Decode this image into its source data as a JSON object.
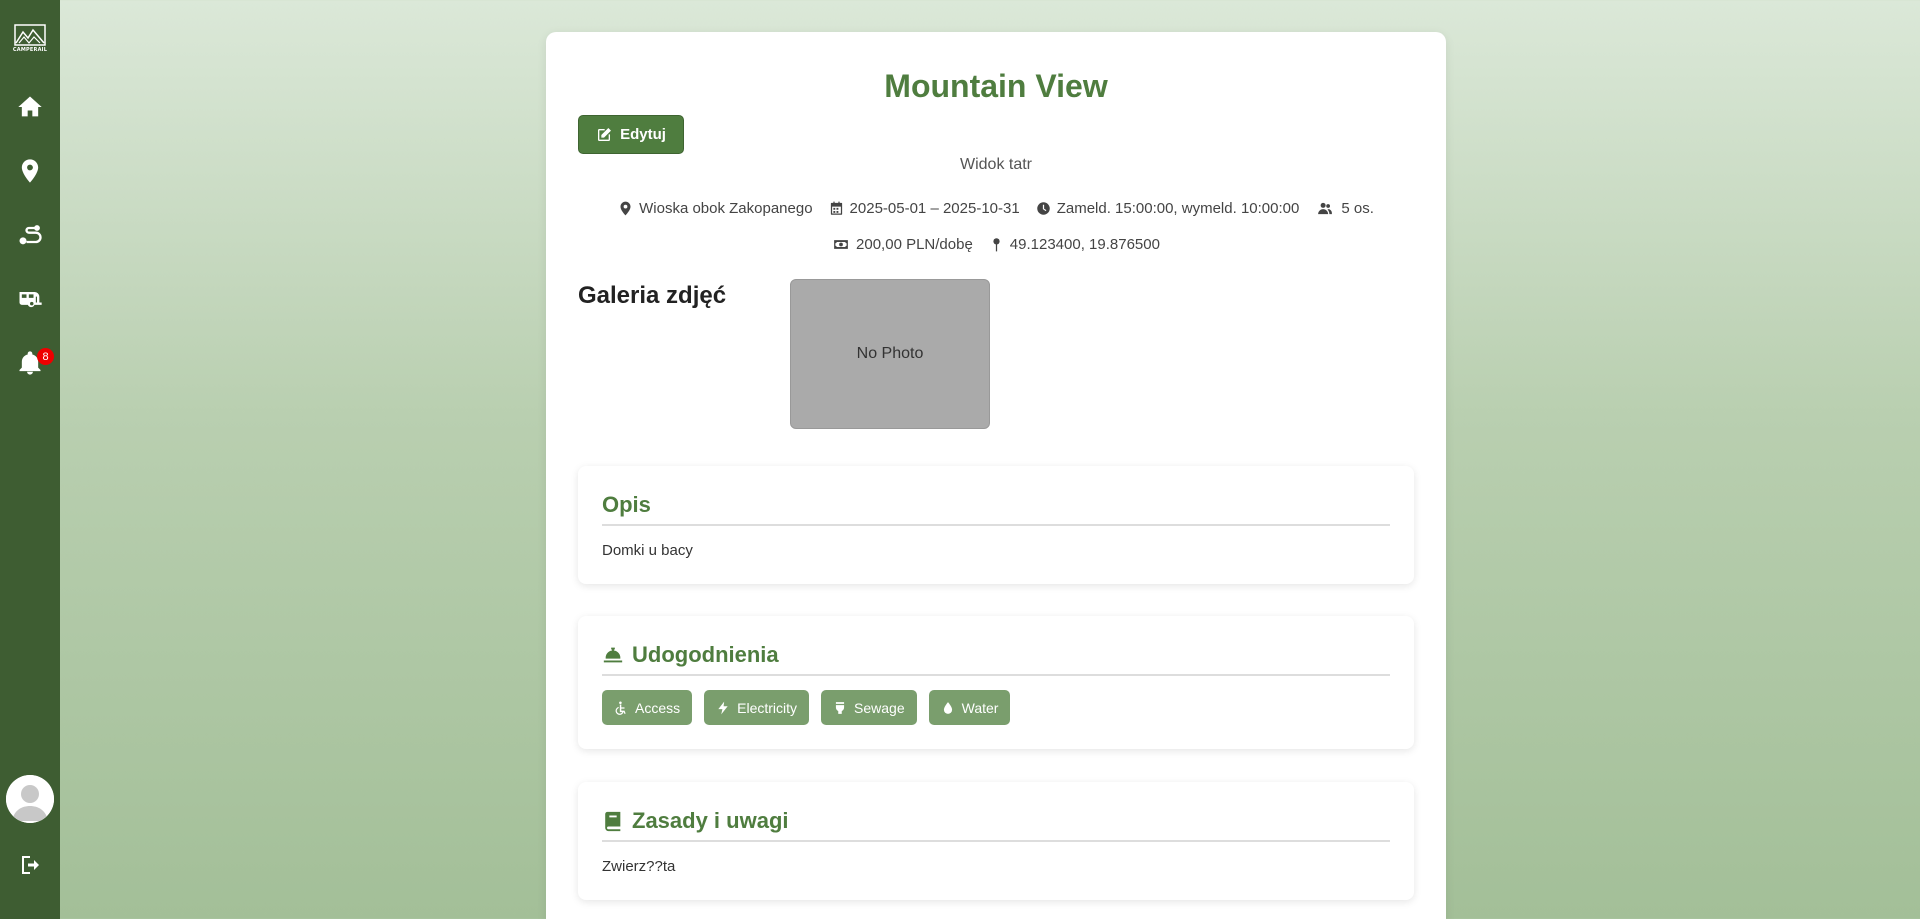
{
  "sidebar": {
    "logo_text": "CAMPERAIL",
    "notifications_count": "8"
  },
  "listing": {
    "title": "Mountain View",
    "edit_label": "Edytuj",
    "subtitle": "Widok tatr",
    "location": "Wioska obok Zakopanego",
    "dates": "2025-05-01 – 2025-10-31",
    "checkin": "Zameld. 15:00:00, wymeld. 10:00:00",
    "guests": "5 os.",
    "price": "200,00 PLN/dobę",
    "coords": "49.123400, 19.876500"
  },
  "gallery": {
    "heading": "Galeria zdjęć",
    "placeholder": "No Photo"
  },
  "description": {
    "heading": "Opis",
    "text": "Domki u bacy"
  },
  "amenities": {
    "heading": "Udogodnienia",
    "items": [
      {
        "label": "Access",
        "icon": "wheelchair-icon"
      },
      {
        "label": "Electricity",
        "icon": "bolt-icon"
      },
      {
        "label": "Sewage",
        "icon": "toilet-icon"
      },
      {
        "label": "Water",
        "icon": "droplet-icon"
      }
    ]
  },
  "rules": {
    "heading": "Zasady i uwagi",
    "text": "Zwierz??ta"
  },
  "colors": {
    "sidebar": "#3e5d32",
    "accent": "#4f7d3f",
    "tag": "#7a9e6d",
    "badge": "#ee0000"
  }
}
